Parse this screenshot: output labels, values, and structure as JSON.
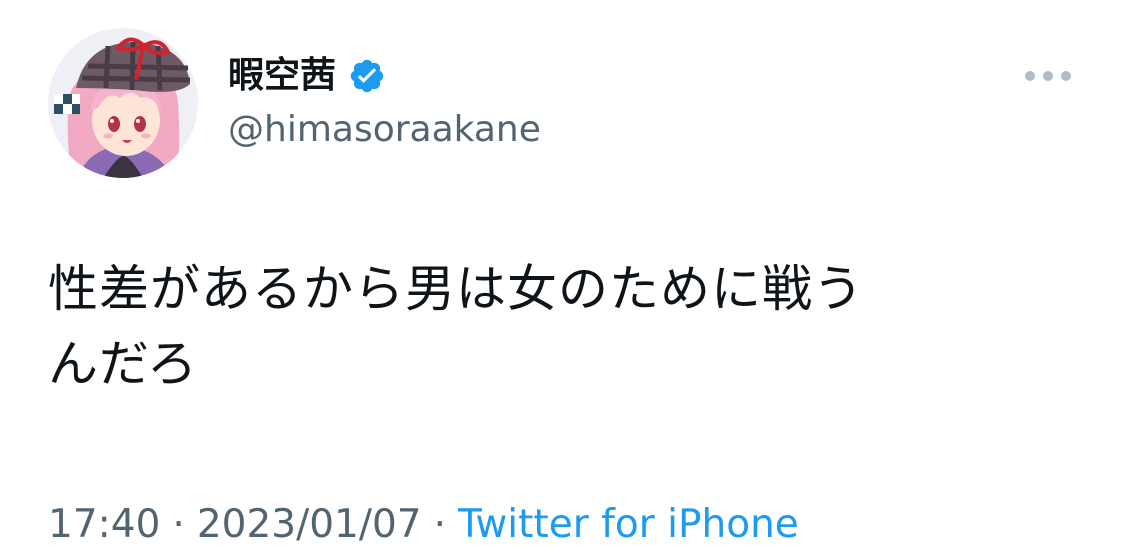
{
  "tweet": {
    "author": {
      "display_name": "暇空茜",
      "handle": "@himasoraakane",
      "verified": true,
      "verified_color": "#1d9bf0"
    },
    "text": "性差があるから男は女のために戦う\nんだろ",
    "time": "17:40",
    "date": "2023/01/07",
    "separator": "·",
    "source": "Twitter for iPhone",
    "link_color": "#1d9bf0"
  }
}
